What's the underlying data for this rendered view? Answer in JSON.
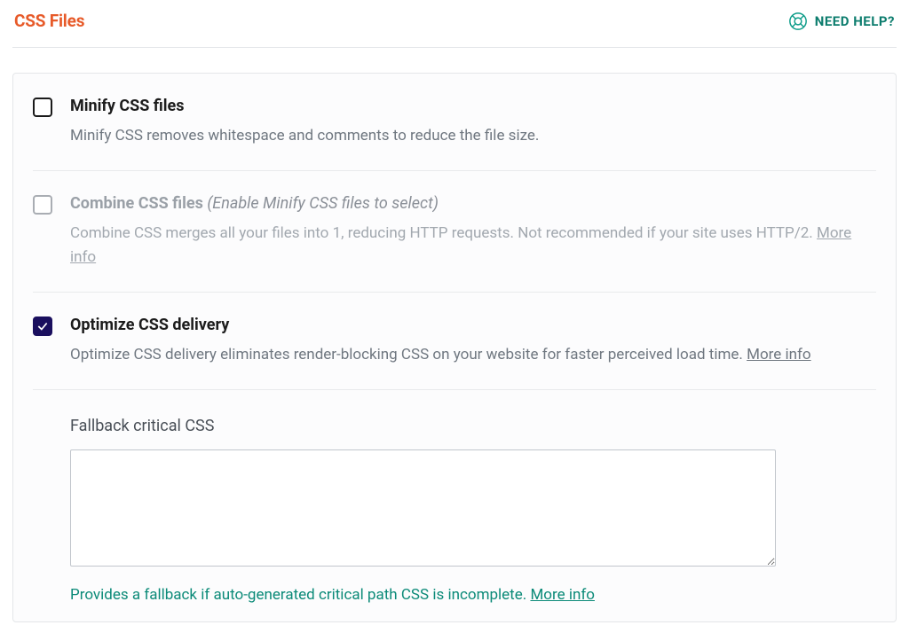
{
  "header": {
    "title": "CSS Files",
    "help_label": "NEED HELP?"
  },
  "options": {
    "minify": {
      "title": "Minify CSS files",
      "description": "Minify CSS removes whitespace and comments to reduce the file size.",
      "checked": false,
      "disabled": false
    },
    "combine": {
      "title": "Combine CSS files",
      "condition": "(Enable Minify CSS files to select)",
      "description": "Combine CSS merges all your files into 1, reducing HTTP requests. Not recommended if your site uses HTTP/2.",
      "more_info": "More info",
      "checked": false,
      "disabled": true
    },
    "optimize": {
      "title": "Optimize CSS delivery",
      "description": "Optimize CSS delivery eliminates render-blocking CSS on your website for faster perceived load time.",
      "more_info": "More info",
      "checked": true,
      "disabled": false
    }
  },
  "fallback": {
    "label": "Fallback critical CSS",
    "value": "",
    "help_text": "Provides a fallback if auto-generated critical path CSS is incomplete.",
    "more_info": "More info"
  }
}
